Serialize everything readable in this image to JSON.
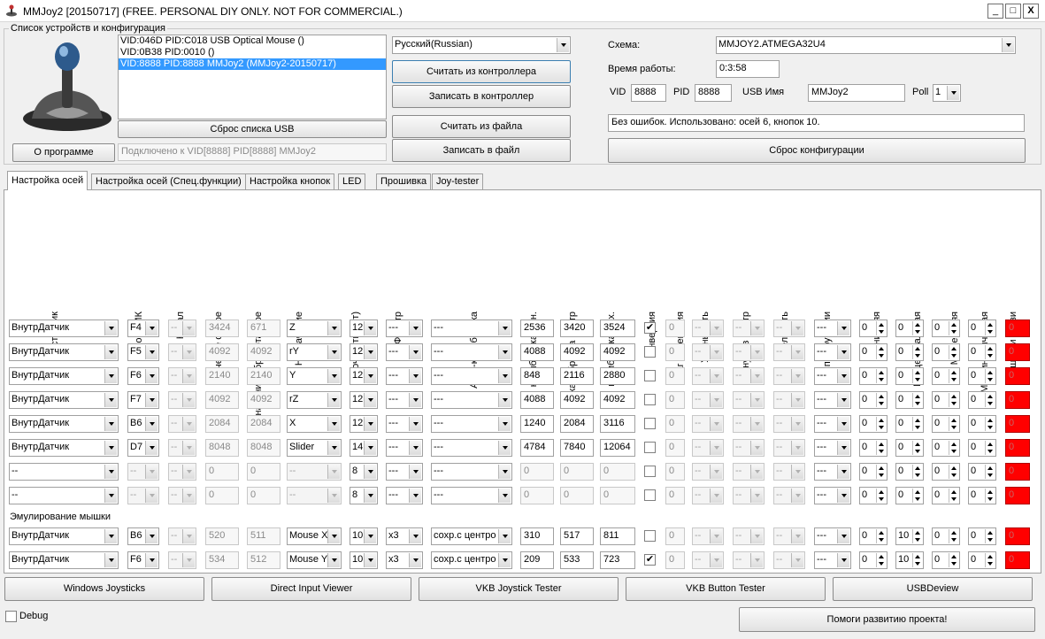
{
  "window": {
    "title": "MMJoy2 [20150717] (FREE. PERSONAL DIY ONLY. NOT FOR COMMERCIAL.)",
    "minimize": "_",
    "maximize": "□",
    "close": "X"
  },
  "devices": {
    "group_label": "Список устройств и конфигурация",
    "items": [
      "VID:046D PID:C018 USB Optical Mouse ()",
      "VID:0B38 PID:0010  ()",
      "VID:8888 PID:8888 MMJoy2 (MMJoy2-20150717)"
    ],
    "reset_usb_button": "Сброс списка USB",
    "connected_text": "Подключено к VID[8888] PID[8888] MMJoy2",
    "about_button": "О программе",
    "language": "Русский(Russian)",
    "read_controller_button": "Считать из контроллера",
    "write_controller_button": "Записать в контроллер",
    "read_file_button": "Считать из файла",
    "write_file_button": "Записать в файл"
  },
  "config": {
    "scheme_label": "Схема:",
    "scheme_value": "MMJOY2.ATMEGA32U4",
    "uptime_label": "Время работы:",
    "uptime_value": "0:3:58",
    "vid_label": "VID",
    "vid_value": "8888",
    "pid_label": "PID",
    "pid_value": "8888",
    "usb_name_label": "USB Имя",
    "usb_name_value": "MMJoy2",
    "poll_label": "Poll",
    "poll_value": "1",
    "status_text": "Без ошибок. Использовано: осей  6, кнопок  10.",
    "reset_config_button": "Сброс конфигурации"
  },
  "tabs": [
    "Настройка осей",
    "Настройка осей (Спец.функции)",
    "Настройка кнопок",
    "LED",
    "Прошивка",
    "Joy-tester"
  ],
  "columns": [
    "Источник",
    "Порт МК",
    "Канал",
    "значение сырое",
    "значение обработанное",
    "Назначение",
    "Точность(бит)",
    "Фильтр",
    "Авто-калибровка",
    "калибровка мин.",
    "калибровка центр",
    "калибровка мах.",
    "Инверсия",
    "Шаг изменения",
    "Уменьшить",
    "Вернуть в центр",
    "Увеличить",
    "Спецфункции",
    "МЗ нижняя",
    "МЗ центральная",
    "МЗ верхняя",
    "МЗ динамическая",
    "ошибки связи"
  ],
  "axis_rows": [
    {
      "source": "ВнутрДатчик",
      "port": "F4",
      "channel": "--",
      "raw": "3424",
      "processed": "671",
      "assign": "Z",
      "bits": "12",
      "filter": "---",
      "autocal": "---",
      "cal_min": "2536",
      "cal_center": "3420",
      "cal_max": "3524",
      "invert": "✔",
      "step": "0",
      "dec": "--",
      "center": "--",
      "inc": "--",
      "special": "---",
      "dz_low": "0",
      "dz_center": "0",
      "dz_high": "0",
      "dz_dyn": "0",
      "errors": "0"
    },
    {
      "source": "ВнутрДатчик",
      "port": "F5",
      "channel": "--",
      "raw": "4092",
      "processed": "4092",
      "assign": "rY",
      "bits": "12",
      "filter": "---",
      "autocal": "---",
      "cal_min": "4088",
      "cal_center": "4092",
      "cal_max": "4092",
      "invert": "",
      "step": "0",
      "dec": "--",
      "center": "--",
      "inc": "--",
      "special": "---",
      "dz_low": "0",
      "dz_center": "0",
      "dz_high": "0",
      "dz_dyn": "0",
      "errors": "0"
    },
    {
      "source": "ВнутрДатчик",
      "port": "F6",
      "channel": "--",
      "raw": "2140",
      "processed": "2140",
      "assign": "Y",
      "bits": "12",
      "filter": "---",
      "autocal": "---",
      "cal_min": "848",
      "cal_center": "2116",
      "cal_max": "2880",
      "invert": "",
      "step": "0",
      "dec": "--",
      "center": "--",
      "inc": "--",
      "special": "---",
      "dz_low": "0",
      "dz_center": "0",
      "dz_high": "0",
      "dz_dyn": "0",
      "errors": "0"
    },
    {
      "source": "ВнутрДатчик",
      "port": "F7",
      "channel": "--",
      "raw": "4092",
      "processed": "4092",
      "assign": "rZ",
      "bits": "12",
      "filter": "---",
      "autocal": "---",
      "cal_min": "4088",
      "cal_center": "4092",
      "cal_max": "4092",
      "invert": "",
      "step": "0",
      "dec": "--",
      "center": "--",
      "inc": "--",
      "special": "---",
      "dz_low": "0",
      "dz_center": "0",
      "dz_high": "0",
      "dz_dyn": "0",
      "errors": "0"
    },
    {
      "source": "ВнутрДатчик",
      "port": "B6",
      "channel": "--",
      "raw": "2084",
      "processed": "2084",
      "assign": "X",
      "bits": "12",
      "filter": "---",
      "autocal": "---",
      "cal_min": "1240",
      "cal_center": "2084",
      "cal_max": "3116",
      "invert": "",
      "step": "0",
      "dec": "--",
      "center": "--",
      "inc": "--",
      "special": "---",
      "dz_low": "0",
      "dz_center": "0",
      "dz_high": "0",
      "dz_dyn": "0",
      "errors": "0"
    },
    {
      "source": "ВнутрДатчик",
      "port": "D7",
      "channel": "--",
      "raw": "8048",
      "processed": "8048",
      "assign": "Slider",
      "bits": "14",
      "filter": "---",
      "autocal": "---",
      "cal_min": "4784",
      "cal_center": "7840",
      "cal_max": "12064",
      "invert": "",
      "step": "0",
      "dec": "--",
      "center": "--",
      "inc": "--",
      "special": "---",
      "dz_low": "0",
      "dz_center": "0",
      "dz_high": "0",
      "dz_dyn": "0",
      "errors": "0"
    },
    {
      "source": "--",
      "port": "--",
      "channel": "--",
      "raw": "0",
      "processed": "0",
      "assign": "--",
      "bits": "8",
      "filter": "---",
      "autocal": "---",
      "cal_min": "0",
      "cal_center": "0",
      "cal_max": "0",
      "invert": "",
      "step": "0",
      "dec": "--",
      "center": "--",
      "inc": "--",
      "special": "---",
      "dz_low": "0",
      "dz_center": "0",
      "dz_high": "0",
      "dz_dyn": "0",
      "errors": "0"
    },
    {
      "source": "--",
      "port": "--",
      "channel": "--",
      "raw": "0",
      "processed": "0",
      "assign": "--",
      "bits": "8",
      "filter": "---",
      "autocal": "---",
      "cal_min": "0",
      "cal_center": "0",
      "cal_max": "0",
      "invert": "",
      "step": "0",
      "dec": "--",
      "center": "--",
      "inc": "--",
      "special": "---",
      "dz_low": "0",
      "dz_center": "0",
      "dz_high": "0",
      "dz_dyn": "0",
      "errors": "0"
    }
  ],
  "mouse_label": "Эмулирование мышки",
  "mouse_rows": [
    {
      "source": "ВнутрДатчик",
      "port": "B6",
      "channel": "--",
      "raw": "520",
      "processed": "511",
      "assign": "Mouse X",
      "bits": "10",
      "filter": "x3",
      "autocal": "сохр.с центро",
      "cal_min": "310",
      "cal_center": "517",
      "cal_max": "811",
      "invert": "",
      "step": "0",
      "dec": "--",
      "center": "--",
      "inc": "--",
      "special": "---",
      "dz_low": "0",
      "dz_center": "10",
      "dz_high": "0",
      "dz_dyn": "0",
      "errors": "0"
    },
    {
      "source": "ВнутрДатчик",
      "port": "F6",
      "channel": "--",
      "raw": "534",
      "processed": "512",
      "assign": "Mouse Y",
      "bits": "10",
      "filter": "x3",
      "autocal": "сохр.с центро",
      "cal_min": "209",
      "cal_center": "533",
      "cal_max": "723",
      "invert": "✔",
      "step": "0",
      "dec": "--",
      "center": "--",
      "inc": "--",
      "special": "---",
      "dz_low": "0",
      "dz_center": "10",
      "dz_high": "0",
      "dz_dyn": "0",
      "errors": "0"
    }
  ],
  "bottom_buttons": [
    "Windows Joysticks",
    "Direct Input Viewer",
    "VKB Joystick Tester",
    "VKB Button Tester",
    "USBDeview"
  ],
  "debug_label": "Debug",
  "help_button": "Помоги развитию проекта!"
}
